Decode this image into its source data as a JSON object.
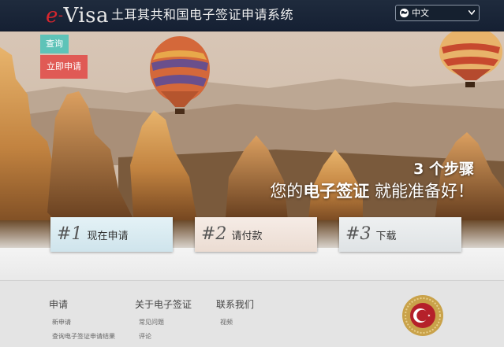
{
  "header": {
    "logo": {
      "e": "e",
      "dash": "-",
      "rest": "Visa"
    },
    "title": "土耳其共和国电子签证申请系统",
    "language": {
      "selected": "中文",
      "icon": "globe-icon"
    }
  },
  "hero": {
    "query_label": "查询",
    "apply_label": "立即申请",
    "headline": {
      "line1": "3 个步骤",
      "line2_pre": "您的",
      "line2_bold": "电子签证",
      "line2_post": " 就能准备好！"
    },
    "steps": [
      {
        "num": "#1",
        "label": "现在申请"
      },
      {
        "num": "#2",
        "label": "请付款"
      },
      {
        "num": "#3",
        "label": "下载"
      }
    ]
  },
  "footer": {
    "columns": [
      {
        "title": "申请",
        "links": [
          "新申请",
          "查询电子签证申请结果"
        ]
      },
      {
        "title": "关于电子签证",
        "links": [
          "常见问题",
          "评论"
        ]
      },
      {
        "title": "联系我们",
        "links": [
          "视频"
        ]
      }
    ]
  },
  "colors": {
    "header_bg": "#1a2638",
    "query_button": "#5ec3b8",
    "apply_button": "#e05a55",
    "logo_accent": "#d8262e"
  }
}
